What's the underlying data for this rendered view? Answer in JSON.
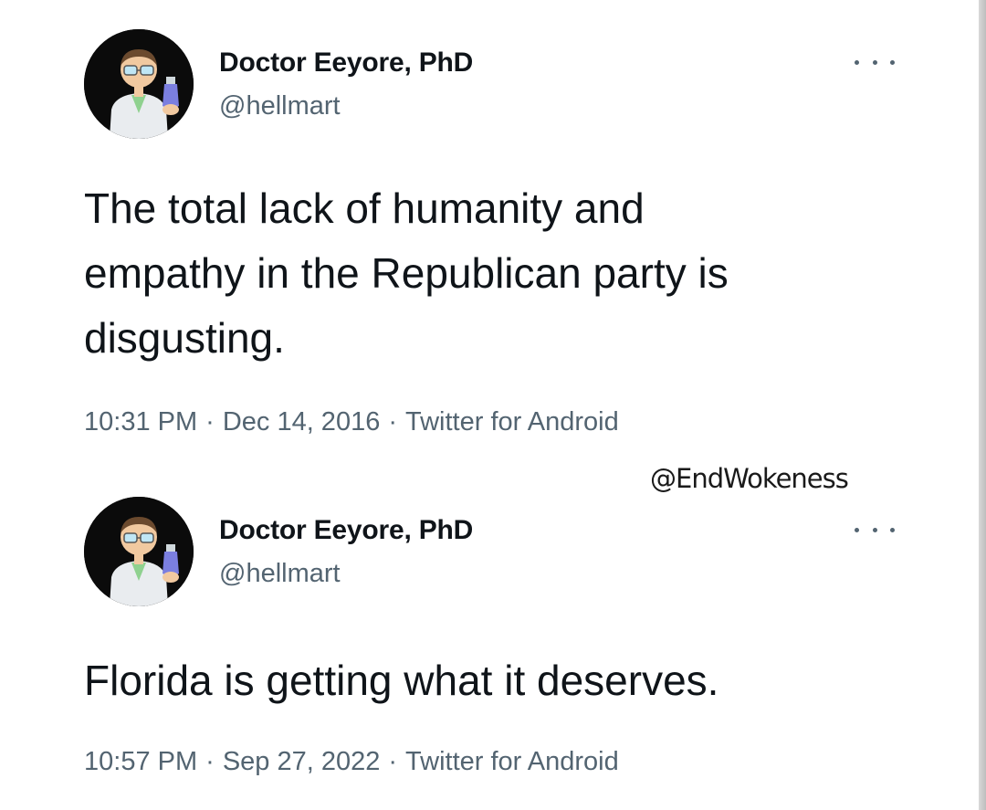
{
  "watermark": "@EndWokeness",
  "tweets": [
    {
      "display_name": "Doctor Eeyore, PhD",
      "handle": "@hellmart",
      "text_lines": [
        "The total lack of humanity and",
        "empathy in the Republican party is",
        "disgusting."
      ],
      "time": "10:31 PM",
      "date": "Dec 14, 2016",
      "source": "Twitter for Android",
      "avatar_icon": "scientist-avatar",
      "menu_icon": "more-options-icon"
    },
    {
      "display_name": "Doctor Eeyore, PhD",
      "handle": "@hellmart",
      "text_lines": [
        "Florida is getting what it deserves."
      ],
      "time": "10:57 PM",
      "date": "Sep 27, 2022",
      "source": "Twitter for Android",
      "avatar_icon": "scientist-avatar",
      "menu_icon": "more-options-icon"
    }
  ],
  "separator": "·",
  "colors": {
    "text": "#0f1419",
    "secondary": "#536471",
    "avatar_background": "#0b0b0b",
    "page_background": "#ffffff"
  }
}
